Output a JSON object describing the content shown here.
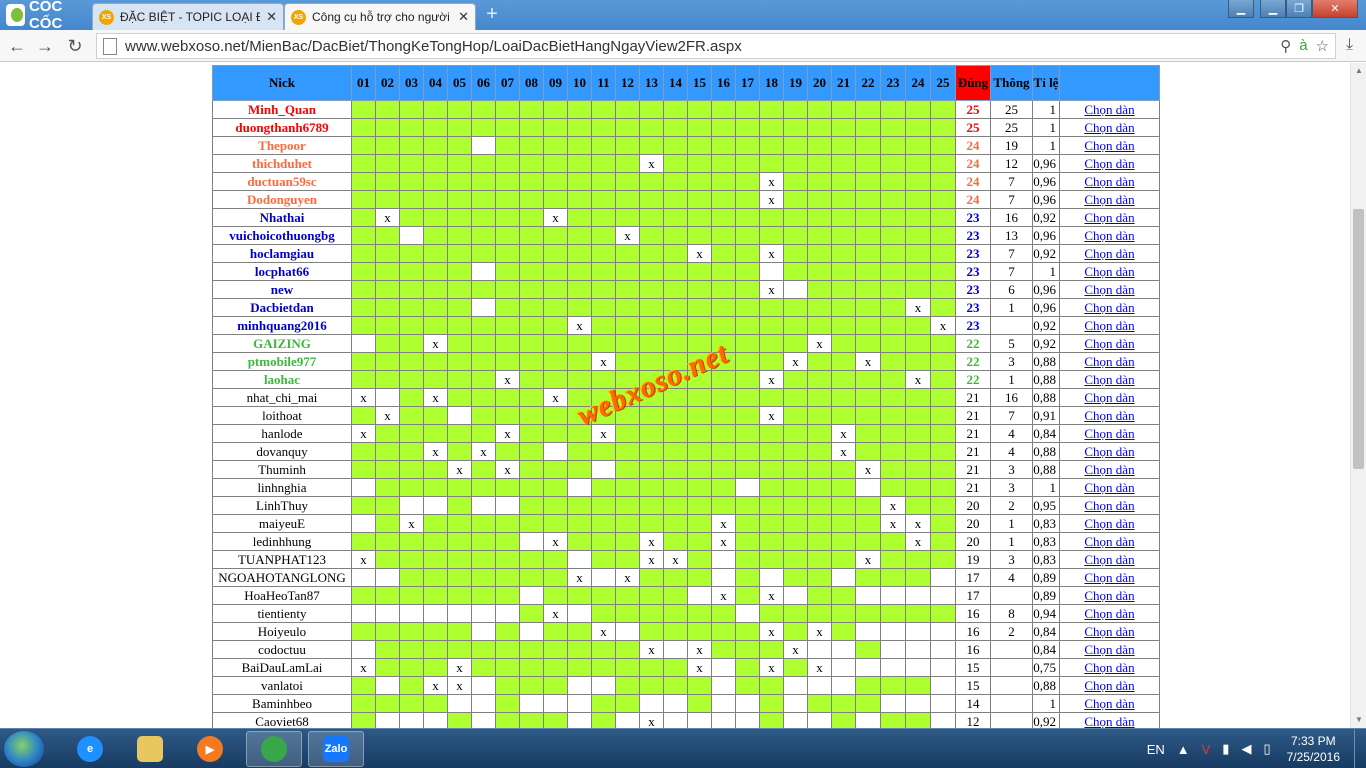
{
  "browser": {
    "logo_text": "CỐC CỐC",
    "tabs": [
      {
        "title": "ĐẶC BIỆT - TOPIC LOẠI ĐẶ",
        "favicon": "XS",
        "close": "✕",
        "active": false
      },
      {
        "title": "Công cụ hỗ trợ cho người",
        "favicon": "XS",
        "close": "✕",
        "active": true
      }
    ],
    "new_tab": "+",
    "url": "www.webxoso.net/MienBac/DacBiet/ThongKeTongHop/LoaiDacBietHangNgayView2FR.aspx"
  },
  "table": {
    "headers": {
      "nick": "Nick",
      "dung": "Đúng",
      "thong": "Thông",
      "tile": "Tỉ lệ",
      "link": ""
    },
    "day_headers": [
      "01",
      "02",
      "03",
      "04",
      "05",
      "06",
      "07",
      "08",
      "09",
      "10",
      "11",
      "12",
      "13",
      "14",
      "15",
      "16",
      "17",
      "18",
      "19",
      "20",
      "21",
      "22",
      "23",
      "24",
      "25"
    ],
    "link_label": "Chọn dàn",
    "name_colors": {
      "red": "#ff0000",
      "orange": "#ff6a3d",
      "blue": "#0000cc",
      "green": "#3cb83c",
      "black": "#000000"
    },
    "rows": [
      {
        "nick": "Minh_Quan",
        "color": "red",
        "bold": true,
        "dung": "25",
        "thong": "25",
        "tile": "1",
        "x": [],
        "w": []
      },
      {
        "nick": "duongthanh6789",
        "color": "red",
        "bold": true,
        "dung": "25",
        "thong": "25",
        "tile": "1",
        "x": [],
        "w": []
      },
      {
        "nick": "Thepoor",
        "color": "orange",
        "bold": true,
        "dung": "24",
        "thong": "19",
        "tile": "1",
        "x": [],
        "w": [
          6
        ]
      },
      {
        "nick": "thichduhet",
        "color": "orange",
        "bold": true,
        "dung": "24",
        "thong": "12",
        "tile": "0,96",
        "x": [
          13
        ],
        "w": []
      },
      {
        "nick": "ductuan59sc",
        "color": "orange",
        "bold": true,
        "dung": "24",
        "thong": "7",
        "tile": "0,96",
        "x": [
          18
        ],
        "w": []
      },
      {
        "nick": "Dodonguyen",
        "color": "orange",
        "bold": true,
        "dung": "24",
        "thong": "7",
        "tile": "0,96",
        "x": [
          18
        ],
        "w": []
      },
      {
        "nick": "Nhathai",
        "color": "blue",
        "bold": true,
        "dung": "23",
        "thong": "16",
        "tile": "0,92",
        "x": [
          2,
          9
        ],
        "w": []
      },
      {
        "nick": "vuichoicothuongbg",
        "color": "blue",
        "bold": true,
        "dung": "23",
        "thong": "13",
        "tile": "0,96",
        "x": [
          12
        ],
        "w": [
          3
        ]
      },
      {
        "nick": "hoclamgiau",
        "color": "blue",
        "bold": true,
        "dung": "23",
        "thong": "7",
        "tile": "0,92",
        "x": [
          15,
          18
        ],
        "w": []
      },
      {
        "nick": "locphat66",
        "color": "blue",
        "bold": true,
        "dung": "23",
        "thong": "7",
        "tile": "1",
        "x": [],
        "w": [
          6,
          18
        ]
      },
      {
        "nick": "new",
        "color": "blue",
        "bold": true,
        "dung": "23",
        "thong": "6",
        "tile": "0,96",
        "x": [
          18
        ],
        "w": [
          19
        ]
      },
      {
        "nick": "Dacbietdan",
        "color": "blue",
        "bold": true,
        "dung": "23",
        "thong": "1",
        "tile": "0,96",
        "x": [
          24
        ],
        "w": [
          6
        ]
      },
      {
        "nick": "minhquang2016",
        "color": "blue",
        "bold": true,
        "dung": "23",
        "thong": "",
        "tile": "0,92",
        "x": [
          10,
          25
        ],
        "w": []
      },
      {
        "nick": "GAIZING",
        "color": "green",
        "bold": true,
        "dung": "22",
        "thong": "5",
        "tile": "0,92",
        "x": [
          4,
          20
        ],
        "w": [
          1
        ]
      },
      {
        "nick": "ptmobile977",
        "color": "green",
        "bold": true,
        "dung": "22",
        "thong": "3",
        "tile": "0,88",
        "x": [
          11,
          19,
          22
        ],
        "w": []
      },
      {
        "nick": "laohac",
        "color": "green",
        "bold": true,
        "dung": "22",
        "thong": "1",
        "tile": "0,88",
        "x": [
          7,
          18,
          24
        ],
        "w": []
      },
      {
        "nick": "nhat_chi_mai",
        "color": "black",
        "bold": false,
        "dung": "21",
        "thong": "16",
        "tile": "0,88",
        "x": [
          1,
          4,
          9
        ],
        "w": [
          2
        ]
      },
      {
        "nick": "loithoat",
        "color": "black",
        "bold": false,
        "dung": "21",
        "thong": "7",
        "tile": "0,91",
        "x": [
          2,
          18
        ],
        "w": [
          5
        ]
      },
      {
        "nick": "hanlode",
        "color": "black",
        "bold": false,
        "dung": "21",
        "thong": "4",
        "tile": "0,84",
        "x": [
          1,
          7,
          11,
          21
        ],
        "w": []
      },
      {
        "nick": "dovanquy",
        "color": "black",
        "bold": false,
        "dung": "21",
        "thong": "4",
        "tile": "0,88",
        "x": [
          4,
          6,
          21
        ],
        "w": [
          9
        ]
      },
      {
        "nick": "Thuminh",
        "color": "black",
        "bold": false,
        "dung": "21",
        "thong": "3",
        "tile": "0,88",
        "x": [
          5,
          7,
          22
        ],
        "w": [
          11
        ]
      },
      {
        "nick": "linhnghia",
        "color": "black",
        "bold": false,
        "dung": "21",
        "thong": "3",
        "tile": "1",
        "x": [],
        "w": [
          1,
          10,
          17,
          22
        ]
      },
      {
        "nick": "LinhThuy",
        "color": "black",
        "bold": false,
        "dung": "20",
        "thong": "2",
        "tile": "0,95",
        "x": [
          23
        ],
        "w": [
          3,
          4,
          6,
          7
        ]
      },
      {
        "nick": "maiyeuE",
        "color": "black",
        "bold": false,
        "dung": "20",
        "thong": "1",
        "tile": "0,83",
        "x": [
          3,
          16,
          23,
          24
        ],
        "w": [
          1
        ]
      },
      {
        "nick": "ledinhhung",
        "color": "black",
        "bold": false,
        "dung": "20",
        "thong": "1",
        "tile": "0,83",
        "x": [
          9,
          13,
          16,
          24
        ],
        "w": [
          8
        ]
      },
      {
        "nick": "TUANPHAT123",
        "color": "black",
        "bold": false,
        "dung": "19",
        "thong": "3",
        "tile": "0,83",
        "x": [
          1,
          13,
          14,
          22
        ],
        "w": [
          10,
          16
        ]
      },
      {
        "nick": "NGOAHOTANGLONG",
        "color": "black",
        "bold": false,
        "dung": "17",
        "thong": "4",
        "tile": "0,89",
        "x": [
          10,
          12
        ],
        "w": [
          1,
          2,
          11,
          16,
          18,
          21,
          25
        ]
      },
      {
        "nick": "HoaHeoTan87",
        "color": "black",
        "bold": false,
        "dung": "17",
        "thong": "",
        "tile": "0,89",
        "x": [
          16,
          18
        ],
        "w": [
          8,
          15,
          19,
          22,
          23,
          24,
          25
        ]
      },
      {
        "nick": "tientienty",
        "color": "black",
        "bold": false,
        "dung": "16",
        "thong": "8",
        "tile": "0,94",
        "x": [
          9
        ],
        "w": [
          1,
          2,
          3,
          4,
          5,
          6,
          7,
          10,
          17
        ]
      },
      {
        "nick": "Hoiyeulo",
        "color": "black",
        "bold": false,
        "dung": "16",
        "thong": "2",
        "tile": "0,84",
        "x": [
          11,
          18,
          20
        ],
        "w": [
          6,
          8,
          12,
          22,
          23,
          24,
          25
        ]
      },
      {
        "nick": "codoctuu",
        "color": "black",
        "bold": false,
        "dung": "16",
        "thong": "",
        "tile": "0,84",
        "x": [
          13,
          15,
          19
        ],
        "w": [
          1,
          14,
          20,
          21,
          23,
          24,
          25
        ]
      },
      {
        "nick": "BaiDauLamLai",
        "color": "black",
        "bold": false,
        "dung": "15",
        "thong": "",
        "tile": "0,75",
        "x": [
          1,
          5,
          15,
          18,
          20
        ],
        "w": [
          16,
          21,
          22,
          23,
          24,
          25
        ]
      },
      {
        "nick": "vanlatoi",
        "color": "black",
        "bold": false,
        "dung": "15",
        "thong": "",
        "tile": "0,88",
        "x": [
          4,
          5
        ],
        "w": [
          2,
          6,
          10,
          11,
          16,
          19,
          20,
          21,
          25
        ]
      },
      {
        "nick": "Baminhbeo",
        "color": "black",
        "bold": false,
        "dung": "14",
        "thong": "",
        "tile": "1",
        "x": [],
        "w": [
          5,
          6,
          8,
          9,
          10,
          13,
          14,
          16,
          17,
          19,
          23,
          24,
          25
        ]
      },
      {
        "nick": "Caoviet68",
        "color": "black",
        "bold": false,
        "dung": "12",
        "thong": "",
        "tile": "0,92",
        "x": [
          13
        ],
        "w": [
          2,
          3,
          4,
          6,
          10,
          12,
          14,
          15,
          16,
          17,
          19,
          20,
          22,
          25
        ]
      }
    ]
  },
  "watermark": "webxoso.net",
  "taskbar": {
    "lang": "EN",
    "time": "7:33 PM",
    "date": "7/25/2016",
    "apps": [
      {
        "name": "Zalo",
        "label": "Zalo"
      }
    ]
  }
}
